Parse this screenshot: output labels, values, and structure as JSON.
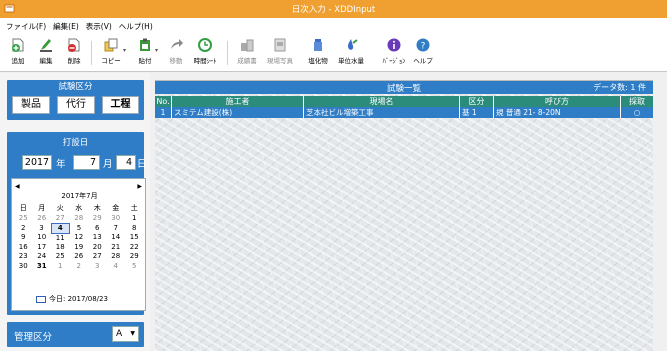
{
  "window": {
    "title": "日次入力 - XDDInput"
  },
  "menu": [
    "ファイル(F)",
    "編集(E)",
    "表示(V)",
    "ヘルプ(H)"
  ],
  "toolbar": [
    {
      "id": "add",
      "label": "追加",
      "icon": "add-icon"
    },
    {
      "id": "edit",
      "label": "編集",
      "icon": "edit-icon"
    },
    {
      "id": "delete",
      "label": "削除",
      "icon": "delete-icon"
    },
    {
      "id": "copy",
      "label": "コピー",
      "icon": "copy-icon"
    },
    {
      "id": "paste",
      "label": "貼付",
      "icon": "paste-icon"
    },
    {
      "id": "move",
      "label": "移動",
      "icon": "move-icon"
    },
    {
      "id": "timesheet",
      "label": "時間ｼｰﾄ",
      "icon": "clock-icon"
    },
    {
      "id": "report",
      "label": "成績書",
      "icon": "report-icon"
    },
    {
      "id": "photo",
      "label": "現場写真",
      "icon": "photo-icon"
    },
    {
      "id": "chloride",
      "label": "塩化物",
      "icon": "chloride-icon"
    },
    {
      "id": "water",
      "label": "単位水量",
      "icon": "water-icon"
    },
    {
      "id": "version",
      "label": "ﾊﾞｰｼﾞｮﾝ",
      "icon": "info-icon"
    },
    {
      "id": "help",
      "label": "ヘルプ",
      "icon": "help-icon"
    }
  ],
  "left": {
    "test_section": {
      "title": "試験区分",
      "buttons": [
        "製品",
        "代行",
        "工程"
      ],
      "active": "工程"
    },
    "date_section": {
      "title": "打設日",
      "year": "2017",
      "year_unit": "年",
      "month": "7",
      "month_unit": "月",
      "day": "4",
      "day_unit": "日"
    },
    "calendar": {
      "title": "2017年7月",
      "prev": "◀",
      "next": "▶",
      "weekdays": [
        "日",
        "月",
        "火",
        "水",
        "木",
        "金",
        "土"
      ],
      "weeks": [
        [
          "25",
          "26",
          "27",
          "28",
          "29",
          "30",
          "1"
        ],
        [
          "2",
          "3",
          "4",
          "5",
          "6",
          "7",
          "8"
        ],
        [
          "9",
          "10",
          "11",
          "12",
          "13",
          "14",
          "15"
        ],
        [
          "16",
          "17",
          "18",
          "19",
          "20",
          "21",
          "22"
        ],
        [
          "23",
          "24",
          "25",
          "26",
          "27",
          "28",
          "29"
        ],
        [
          "30",
          "31",
          "1",
          "2",
          "3",
          "4",
          "5"
        ]
      ],
      "today_label": "今日: 2017/08/23"
    },
    "management": {
      "label": "管理区分",
      "value": "A"
    }
  },
  "list": {
    "title": "試験一覧",
    "count": "データ数: 1 件",
    "columns": [
      "No.",
      "施工者",
      "現場名",
      "区分",
      "呼び方",
      "採取"
    ],
    "rows": [
      [
        "1",
        "スミテム建設(株)",
        "芝本社ビル増築工事",
        "基 1",
        "規 普通 21- 8-20N",
        "○"
      ]
    ]
  },
  "colors": {
    "title_bar": "#f0a030",
    "panel_blue": "#2f7dc7",
    "grid_header": "#2c8c7c"
  }
}
